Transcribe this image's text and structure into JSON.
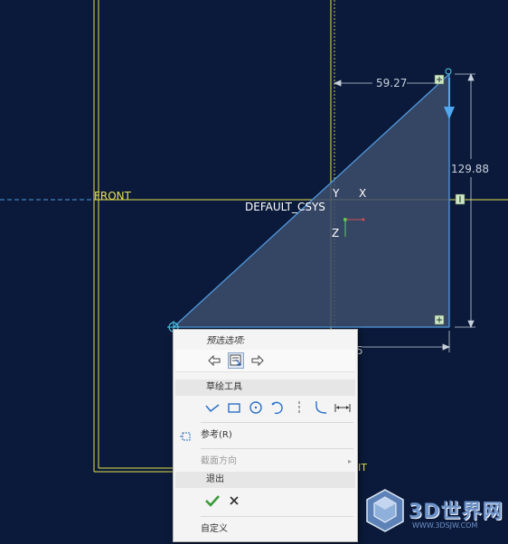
{
  "viewport": {
    "dim_top": "59.27",
    "dim_right": "129.88",
    "dim_bottom": "5",
    "plane_front": "FRONT",
    "plane_right_partial": "IT",
    "csys_label": "DEFAULT_CSYS",
    "axis_y": "Y",
    "axis_x": "X",
    "axis_z": "Z",
    "colors": {
      "background": "#0b1a3a",
      "sketch_line": "#4f9be0",
      "fill": "#3d4e6c",
      "datum_plane": "#e5e04a",
      "dim": "#c8d0dc"
    }
  },
  "context_menu": {
    "preselect_title": "预选选项:",
    "tools_title": "草绘工具",
    "reference": "参考(R)",
    "section_direction": "截面方向",
    "exit_title": "退出",
    "customize": "自定义"
  },
  "watermark": {
    "text": "3D世界网",
    "url": "WWW.3DSJW.COM"
  }
}
